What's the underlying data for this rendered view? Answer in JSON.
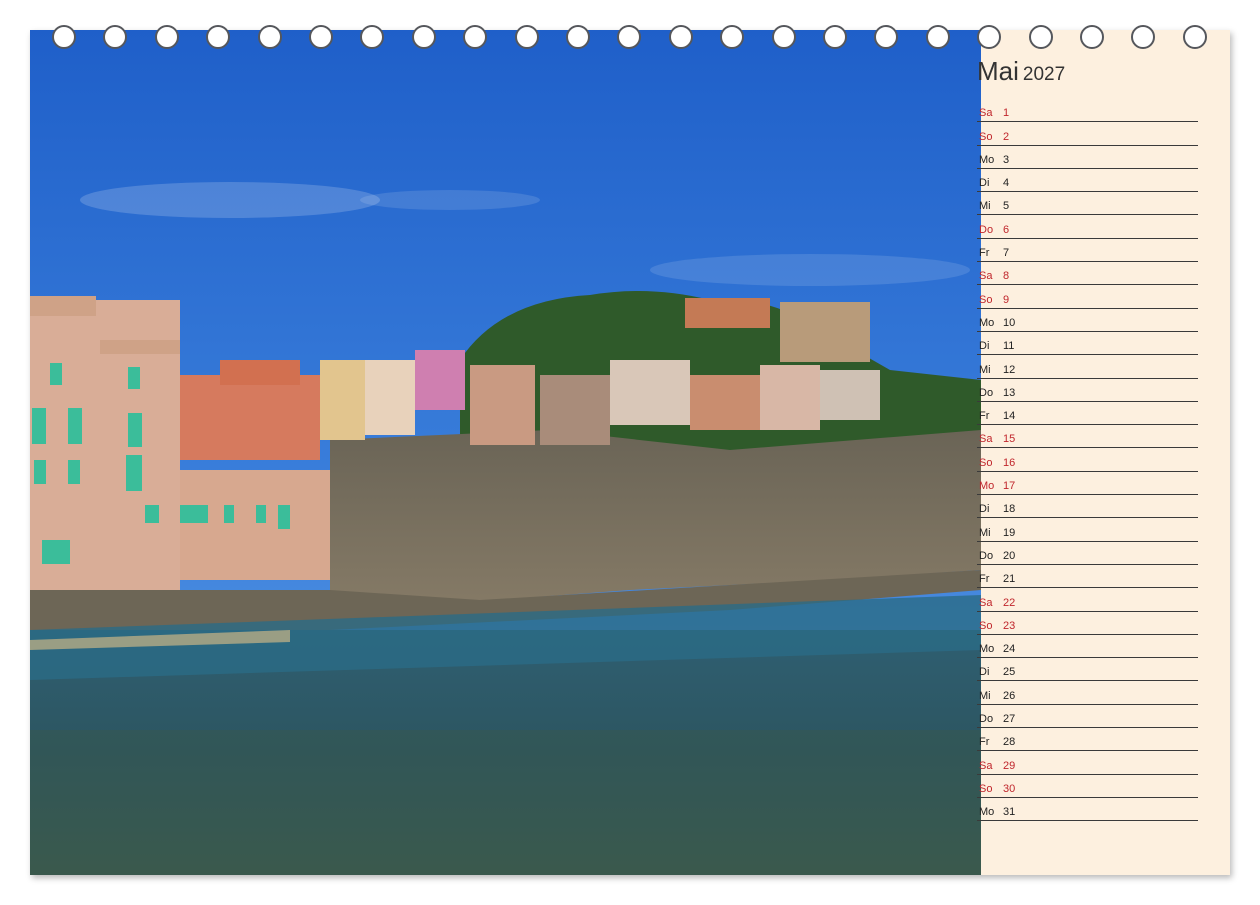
{
  "calendar": {
    "month": "Mai",
    "year": "2027",
    "colors": {
      "weekend": "#c0262c",
      "weekday": "#222222",
      "panel": "#fdf0df"
    },
    "days": [
      {
        "wd": "Sa",
        "d": "1",
        "weekend": true
      },
      {
        "wd": "So",
        "d": "2",
        "weekend": true
      },
      {
        "wd": "Mo",
        "d": "3",
        "weekend": false
      },
      {
        "wd": "Di",
        "d": "4",
        "weekend": false
      },
      {
        "wd": "Mi",
        "d": "5",
        "weekend": false
      },
      {
        "wd": "Do",
        "d": "6",
        "weekend": true
      },
      {
        "wd": "Fr",
        "d": "7",
        "weekend": false
      },
      {
        "wd": "Sa",
        "d": "8",
        "weekend": true
      },
      {
        "wd": "So",
        "d": "9",
        "weekend": true
      },
      {
        "wd": "Mo",
        "d": "10",
        "weekend": false
      },
      {
        "wd": "Di",
        "d": "11",
        "weekend": false
      },
      {
        "wd": "Mi",
        "d": "12",
        "weekend": false
      },
      {
        "wd": "Do",
        "d": "13",
        "weekend": false
      },
      {
        "wd": "Fr",
        "d": "14",
        "weekend": false
      },
      {
        "wd": "Sa",
        "d": "15",
        "weekend": true
      },
      {
        "wd": "So",
        "d": "16",
        "weekend": true
      },
      {
        "wd": "Mo",
        "d": "17",
        "weekend": true
      },
      {
        "wd": "Di",
        "d": "18",
        "weekend": false
      },
      {
        "wd": "Mi",
        "d": "19",
        "weekend": false
      },
      {
        "wd": "Do",
        "d": "20",
        "weekend": false
      },
      {
        "wd": "Fr",
        "d": "21",
        "weekend": false
      },
      {
        "wd": "Sa",
        "d": "22",
        "weekend": true
      },
      {
        "wd": "So",
        "d": "23",
        "weekend": true
      },
      {
        "wd": "Mo",
        "d": "24",
        "weekend": false
      },
      {
        "wd": "Di",
        "d": "25",
        "weekend": false
      },
      {
        "wd": "Mi",
        "d": "26",
        "weekend": false
      },
      {
        "wd": "Do",
        "d": "27",
        "weekend": false
      },
      {
        "wd": "Fr",
        "d": "28",
        "weekend": false
      },
      {
        "wd": "Sa",
        "d": "29",
        "weekend": true
      },
      {
        "wd": "So",
        "d": "30",
        "weekend": true
      },
      {
        "wd": "Mo",
        "d": "31",
        "weekend": false
      }
    ]
  }
}
